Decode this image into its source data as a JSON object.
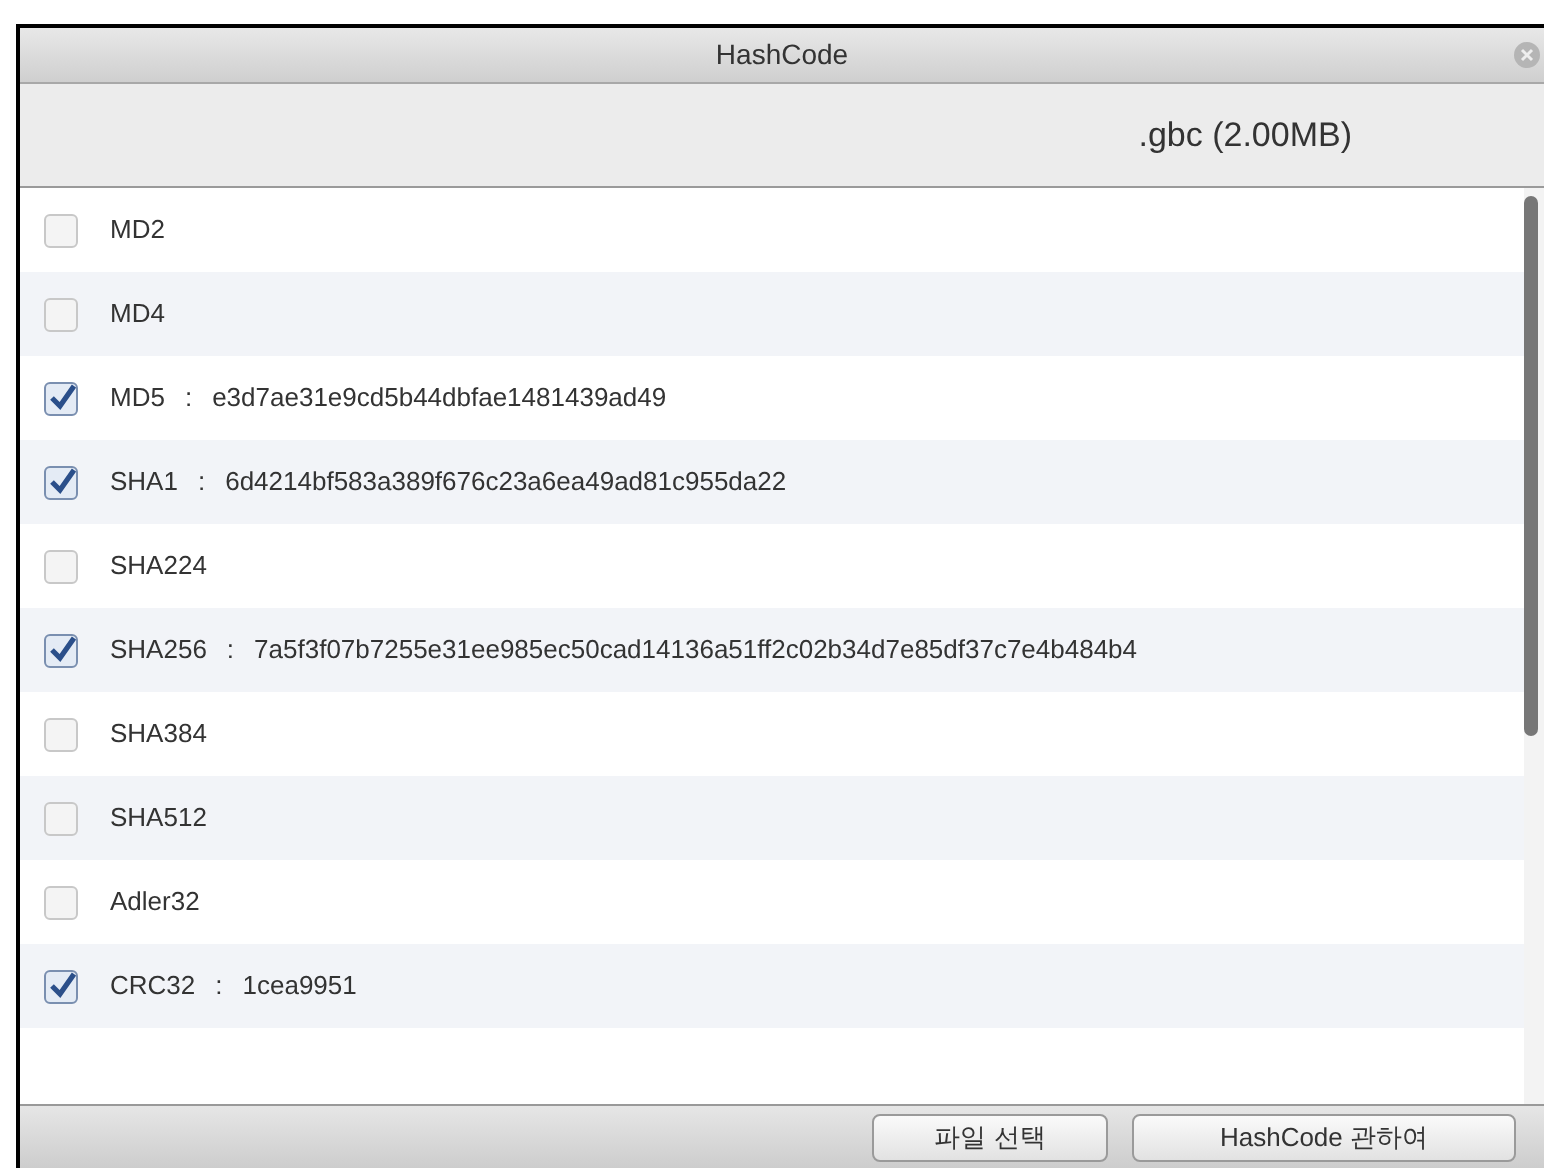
{
  "window": {
    "title": "HashCode"
  },
  "file_info": ".gbc (2.00MB)",
  "separator": ":",
  "algorithms": [
    {
      "name": "MD2",
      "checked": false
    },
    {
      "name": "MD4",
      "checked": false
    },
    {
      "name": "MD5",
      "checked": true,
      "hash": "e3d7ae31e9cd5b44dbfae1481439ad49"
    },
    {
      "name": "SHA1",
      "checked": true,
      "hash": "6d4214bf583a389f676c23a6ea49ad81c955da22"
    },
    {
      "name": "SHA224",
      "checked": false
    },
    {
      "name": "SHA256",
      "checked": true,
      "hash": "7a5f3f07b7255e31ee985ec50cad14136a51ff2c02b34d7e85df37c7e4b484b4"
    },
    {
      "name": "SHA384",
      "checked": false
    },
    {
      "name": "SHA512",
      "checked": false
    },
    {
      "name": "Adler32",
      "checked": false
    },
    {
      "name": "CRC32",
      "checked": true,
      "hash": "1cea9951"
    }
  ],
  "buttons": [
    "파일 선택",
    "HashCode 관하여"
  ]
}
